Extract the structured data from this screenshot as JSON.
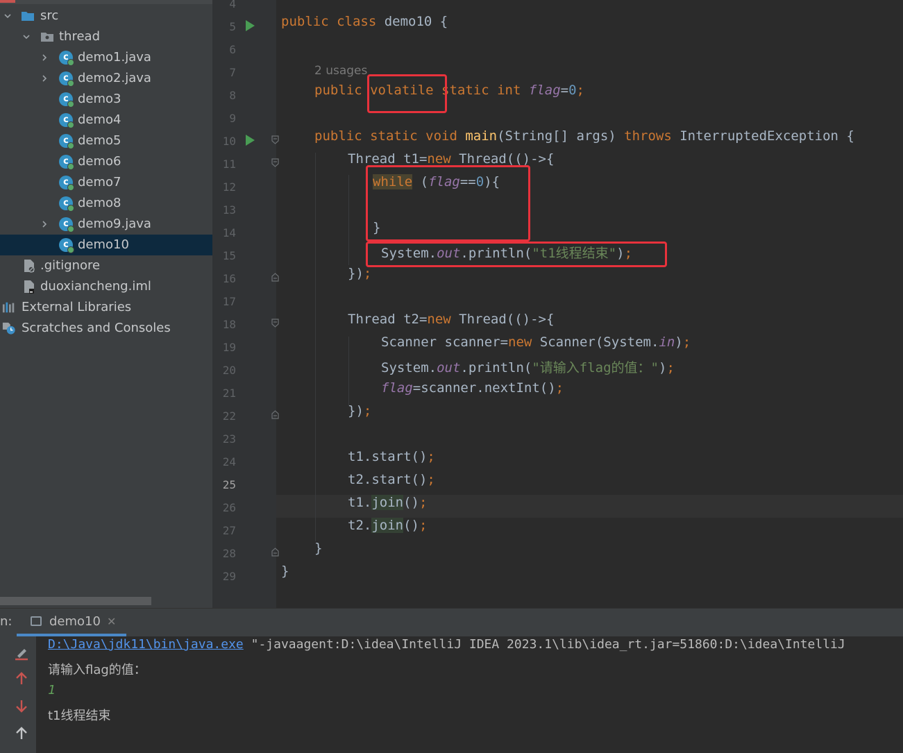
{
  "project_tree": {
    "items": [
      {
        "label": "src",
        "icon": "folder-icon"
      },
      {
        "label": "thread",
        "icon": "package-icon"
      },
      {
        "label": "demo1.java",
        "icon": "java-class-icon"
      },
      {
        "label": "demo2.java",
        "icon": "java-class-icon"
      },
      {
        "label": "demo3",
        "icon": "java-class-icon"
      },
      {
        "label": "demo4",
        "icon": "java-class-icon"
      },
      {
        "label": "demo5",
        "icon": "java-class-icon"
      },
      {
        "label": "demo6",
        "icon": "java-class-icon"
      },
      {
        "label": "demo7",
        "icon": "java-class-icon"
      },
      {
        "label": "demo8",
        "icon": "java-class-icon"
      },
      {
        "label": "demo9.java",
        "icon": "java-class-icon"
      },
      {
        "label": "demo10",
        "icon": "java-class-icon"
      },
      {
        "label": ".gitignore",
        "icon": "ignore-file-icon"
      },
      {
        "label": "duoxiancheng.iml",
        "icon": "module-file-icon"
      },
      {
        "label": "External Libraries",
        "icon": "libraries-icon"
      },
      {
        "label": "Scratches and Consoles",
        "icon": "scratches-icon"
      }
    ],
    "selected": "demo10"
  },
  "editor": {
    "line_numbers": [
      "4",
      "5",
      "6",
      "7",
      "8",
      "9",
      "10",
      "11",
      "12",
      "13",
      "14",
      "15",
      "16",
      "17",
      "18",
      "19",
      "20",
      "21",
      "22",
      "23",
      "24",
      "25",
      "26",
      "27",
      "28",
      "29"
    ],
    "current_line": "25",
    "usages_hint": "2 usages",
    "code": {
      "l5": {
        "kw1": "public class ",
        "name": "demo10 {"
      },
      "l7": {
        "kw1": "public ",
        "kw2": "volatile",
        "kw3": " static int ",
        "field": "flag",
        "eq": "=",
        "num": "0",
        "semi": ";"
      },
      "l9": {
        "kw": "public static void ",
        "fn": "main",
        "rest": "(String[] args) ",
        "kw2": "throws",
        "rest2": " InterruptedException {"
      },
      "l10": {
        "a": "Thread t1=",
        "kw": "new",
        "b": " Thread(()->{"
      },
      "l11": {
        "kw": "while",
        "a": " (",
        "field": "flag",
        "b": "==",
        "num": "0",
        "c": "){"
      },
      "l13": {
        "a": "}"
      },
      "l14": {
        "a": "System.",
        "field": "out",
        "b": ".println(",
        "str": "\"t1线程结束\"",
        "c": ")",
        "semi": ";"
      },
      "l15": {
        "a": "})",
        "semi": ";"
      },
      "l17": {
        "a": "Thread t2=",
        "kw": "new",
        "b": " Thread(()->{"
      },
      "l18": {
        "a": "Scanner scanner=",
        "kw": "new",
        "b": " Scanner(System.",
        "field": "in",
        "c": ")",
        "semi": ";"
      },
      "l19": {
        "a": "System.",
        "field": "out",
        "b": ".println(",
        "str": "\"请输入flag的值：\"",
        "c": ")",
        "semi": ";"
      },
      "l20": {
        "field": "flag",
        "a": "=scanner.nextInt()",
        "semi": ";"
      },
      "l21": {
        "a": "})",
        "semi": ";"
      },
      "l23": {
        "a": "t1.start()",
        "semi": ";"
      },
      "l24": {
        "a": "t2.start()",
        "semi": ";"
      },
      "l25": {
        "a": "t1.",
        "join": "join",
        "b": "()",
        "semi": ";"
      },
      "l26": {
        "a": "t2.",
        "join": "join",
        "b": "()",
        "semi": ";"
      },
      "l27": {
        "a": "}"
      },
      "l28": {
        "a": "}"
      }
    }
  },
  "run_panel": {
    "prefix": "n:",
    "tab_label": "demo10",
    "tab_close": "✕",
    "toolbar_icons": [
      "rerun-icon",
      "scroll-up-icon",
      "scroll-down-icon",
      "scroll-top-icon"
    ],
    "console": {
      "cmd_link": "D:\\Java\\jdk11\\bin\\java.exe",
      "cmd_rest": " \"-javaagent:D:\\idea\\IntelliJ IDEA 2023.1\\lib\\idea_rt.jar=51860:D:\\idea\\IntelliJ",
      "line2": "请输入flag的值：",
      "line3": "1",
      "line4": "t1线程结束"
    }
  },
  "colors": {
    "keyword": "#cc7832",
    "method": "#ffc66d",
    "field": "#9876aa",
    "number": "#6897bb",
    "string": "#6a8759",
    "annotation_box": "#e8323c",
    "selection": "#0d293e"
  }
}
